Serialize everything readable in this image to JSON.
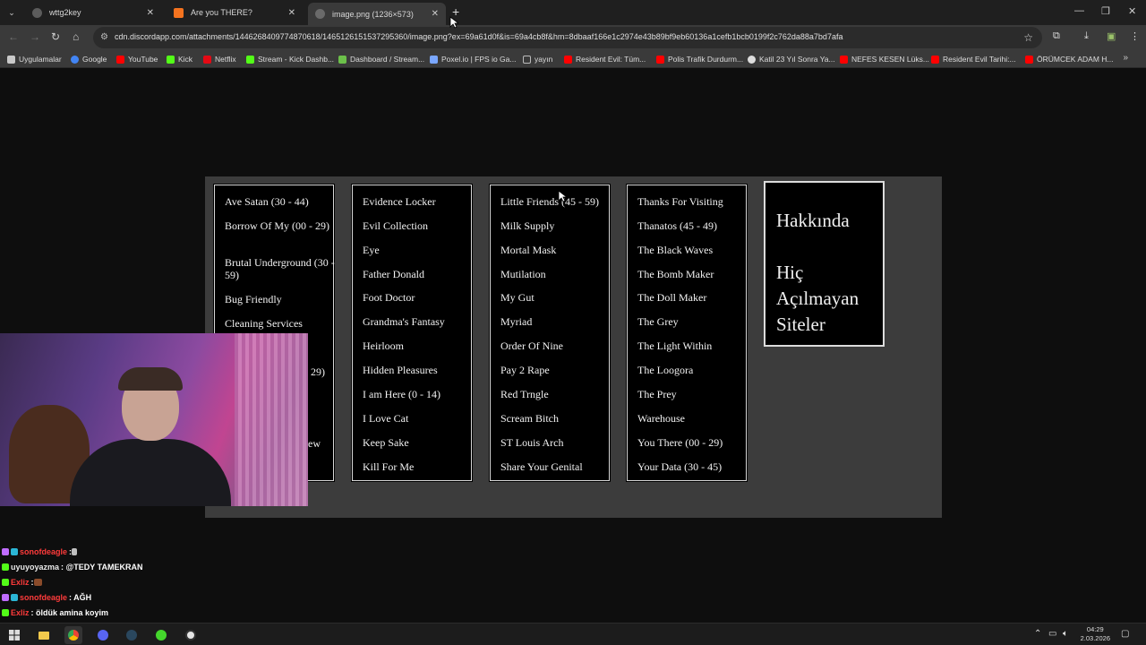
{
  "browser": {
    "tabs": [
      {
        "title": "wttg2key",
        "favicon_color": "#5c5c5c"
      },
      {
        "title": "Are you THERE?",
        "favicon_color": "#f4731f"
      },
      {
        "title": "image.png (1236×573)",
        "favicon_color": "#6a6a6a"
      }
    ],
    "url": "cdn.discordapp.com/attachments/1446268409774870618/1465126151537295360/image.png?ex=69a61d0f&is=69a4cb8f&hm=8dbaaf166e1c2974e43b89bf9eb60136a1cefb1bcb0199f2c762da88a7bd7afa"
  },
  "bookmarks": [
    {
      "label": "Uygulamalar",
      "color": "#c9c9c9"
    },
    {
      "label": "Google",
      "color": "#4285f4"
    },
    {
      "label": "YouTube",
      "color": "#ff0000"
    },
    {
      "label": "Kick",
      "color": "#53fc18"
    },
    {
      "label": "Netflix",
      "color": "#e50914"
    },
    {
      "label": "Stream - Kick Dashb...",
      "color": "#53fc18"
    },
    {
      "label": "Dashboard / Stream...",
      "color": "#6cc04a"
    },
    {
      "label": "Poxel.io | FPS io Ga...",
      "color": "#7aa7ff"
    },
    {
      "label": "yayın",
      "color": "#bbbbbb"
    },
    {
      "label": "Resident Evil: Tüm...",
      "color": "#ff0000"
    },
    {
      "label": "Polis Trafik Durdurm...",
      "color": "#ff0000"
    },
    {
      "label": "Katil 23 Yıl Sonra Ya...",
      "color": "#dddddd"
    },
    {
      "label": "NEFES KESEN Lüks...",
      "color": "#ff0000"
    },
    {
      "label": "Resident Evil Tarihi:...",
      "color": "#ff0000"
    },
    {
      "label": "ÖRÜMCEK ADAM H...",
      "color": "#ff0000"
    }
  ],
  "site_list": {
    "col1": [
      "Ave Satan (30 - 44)",
      "Borrow Of My (00 - 29)",
      "Brutal Underground (30 - 59)",
      "Bug Friendly",
      "Cleaning Services",
      "29)",
      "ew"
    ],
    "col2": [
      "Evidence Locker",
      "Evil Collection",
      "Eye",
      "Father Donald",
      "Foot Doctor",
      "Grandma's Fantasy",
      "Heirloom",
      "Hidden Pleasures",
      "I am Here (0 - 14)",
      "I Love Cat",
      "Keep Sake",
      "Kill For Me"
    ],
    "col3": [
      "Little Friends (45 - 59)",
      "Milk Supply",
      "Mortal Mask",
      "Mutilation",
      "My Gut",
      "Myriad",
      "Order Of Nine",
      "Pay 2 Rape",
      "Red Trngle",
      "Scream Bitch",
      "ST Louis Arch",
      "Share Your Genital"
    ],
    "col4": [
      "Thanks For Visiting",
      "Thanatos (45 - 49)",
      "The Black Waves",
      "The Bomb Maker",
      "The Doll Maker",
      "The Grey",
      "The Light Within",
      "The Loogora",
      "The Prey",
      "Warehouse",
      "You There (00 - 29)",
      "Your Data (30 - 45)"
    ],
    "about_heading": "Hakkında",
    "about_sub": [
      "Hiç",
      "Açılmayan",
      "Siteler"
    ]
  },
  "chat": [
    {
      "user": "sonofdeagle",
      "user_color": "#ff3b3b",
      "message": ": ",
      "badges": [
        "#c06cff",
        "#2bb6d6"
      ]
    },
    {
      "user": "uyuyoyazma",
      "user_color": "#e9e9e9",
      "message": ": @TEDY TAMEKRAN",
      "badges": [
        "#53fc18"
      ]
    },
    {
      "user": "Exliz",
      "user_color": "#ff3b3b",
      "message": ": ",
      "badges": [
        "#53fc18"
      ]
    },
    {
      "user": "sonofdeagle",
      "user_color": "#ff3b3b",
      "message": ": AĞH",
      "badges": [
        "#c06cff",
        "#2bb6d6"
      ]
    },
    {
      "user": "Exliz",
      "user_color": "#ff3b3b",
      "message": ": öldük amina koyim",
      "badges": [
        "#53fc18"
      ]
    }
  ],
  "taskbar": {
    "time": "04:29",
    "date": "2.03.2026"
  }
}
